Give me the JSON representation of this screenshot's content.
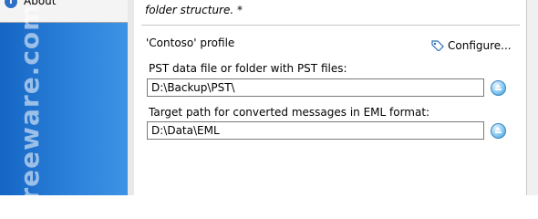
{
  "sidebar": {
    "about_label": "About",
    "watermark": "Freeware.com"
  },
  "main": {
    "note": "folder structure. *",
    "profile_label": "'Contoso' profile",
    "configure_label": "Configure...",
    "pst_label": "PST data file or folder with PST files:",
    "pst_value": "D:\\Backup\\PST\\",
    "target_label": "Target path for converted messages in EML format:",
    "target_value": "D:\\Data\\EML"
  },
  "icons": {
    "about": "info-icon",
    "configure": "tag-icon",
    "browse": "eject-icon"
  },
  "colors": {
    "sidebar": "#2a80d8",
    "accent": "#3a96d6"
  }
}
